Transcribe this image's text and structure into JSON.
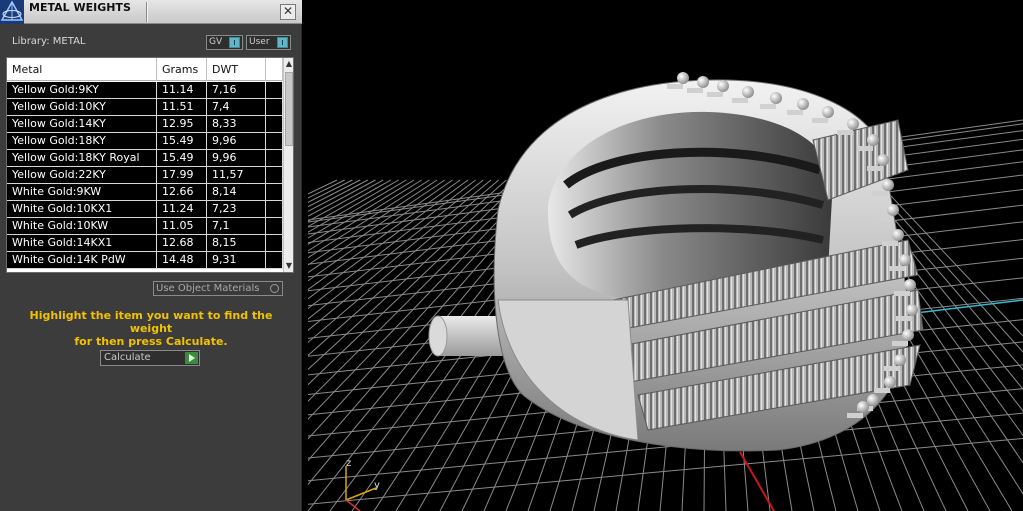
{
  "panel": {
    "title": "METAL WEIGHTS",
    "close_glyph": "✕",
    "library_label": "Library: METAL",
    "toggles": [
      {
        "label": "GV"
      },
      {
        "label": "User"
      }
    ],
    "icons": {
      "app": "gem-logo-icon",
      "close": "close-icon",
      "scroll_up": "chevron-up-icon",
      "scroll_down": "chevron-down-icon",
      "calculate": "play-icon"
    }
  },
  "table": {
    "columns": [
      "Metal",
      "Grams",
      "DWT"
    ],
    "rows": [
      {
        "metal": "Yellow Gold:9KY",
        "grams": "11.14",
        "dwt": "7,16"
      },
      {
        "metal": "Yellow Gold:10KY",
        "grams": "11.51",
        "dwt": "7,4"
      },
      {
        "metal": "Yellow Gold:14KY",
        "grams": "12.95",
        "dwt": "8,33"
      },
      {
        "metal": "Yellow Gold:18KY",
        "grams": "15.49",
        "dwt": "9,96"
      },
      {
        "metal": "Yellow Gold:18KY Royal",
        "grams": "15.49",
        "dwt": "9,96"
      },
      {
        "metal": "Yellow Gold:22KY",
        "grams": "17.99",
        "dwt": "11,57"
      },
      {
        "metal": "White Gold:9KW",
        "grams": "12.66",
        "dwt": "8,14"
      },
      {
        "metal": "White Gold:10KX1",
        "grams": "11.24",
        "dwt": "7,23"
      },
      {
        "metal": "White Gold:10KW",
        "grams": "11.05",
        "dwt": "7,1"
      },
      {
        "metal": "White Gold:14KX1",
        "grams": "12.68",
        "dwt": "8,15"
      },
      {
        "metal": "White Gold:14K PdW",
        "grams": "14.48",
        "dwt": "9,31"
      }
    ],
    "scroll_up_glyph": "▲",
    "scroll_down_glyph": "▼"
  },
  "options": {
    "use_object_materials": "Use Object Materials"
  },
  "instruction": {
    "line1": "Highlight the item you want to find the weight",
    "line2": "for then press Calculate."
  },
  "calculate": {
    "label": "Calculate"
  },
  "viewport": {
    "axis_labels": {
      "z": "z",
      "y": "y"
    },
    "colors": {
      "background": "#000000",
      "grid": "#8a8a8a",
      "x_axis": "#c81818",
      "y_axis": "#38b8d0",
      "ring": "#c8c8c8"
    }
  }
}
